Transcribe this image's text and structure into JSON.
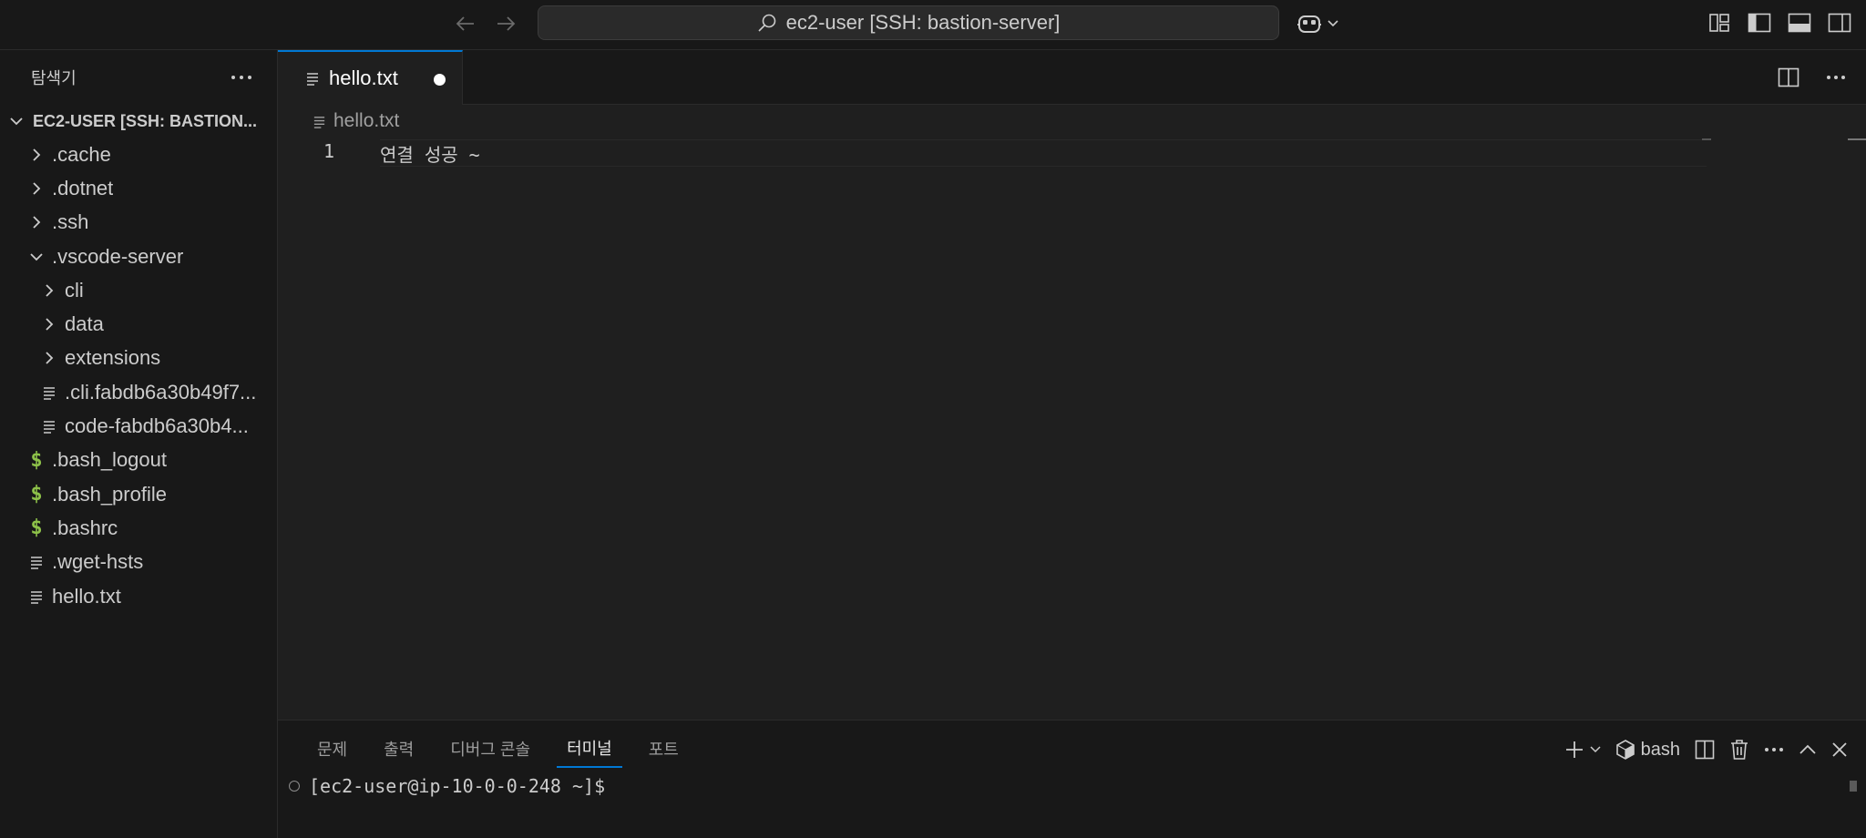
{
  "titlebar": {
    "search_text": "ec2-user [SSH: bastion-server]"
  },
  "sidebar": {
    "title": "탐색기",
    "root_label": "EC2-USER [SSH: BASTION...",
    "items": [
      {
        "label": ".cache",
        "type": "folder-collapsed"
      },
      {
        "label": ".dotnet",
        "type": "folder-collapsed"
      },
      {
        "label": ".ssh",
        "type": "folder-collapsed"
      },
      {
        "label": ".vscode-server",
        "type": "folder-expanded"
      },
      {
        "label": "cli",
        "type": "folder-collapsed"
      },
      {
        "label": "data",
        "type": "folder-collapsed"
      },
      {
        "label": "extensions",
        "type": "folder-collapsed"
      },
      {
        "label": ".cli.fabdb6a30b49f7...",
        "type": "file"
      },
      {
        "label": "code-fabdb6a30b4...",
        "type": "file"
      },
      {
        "label": ".bash_logout",
        "type": "shell"
      },
      {
        "label": ".bash_profile",
        "type": "shell"
      },
      {
        "label": ".bashrc",
        "type": "shell"
      },
      {
        "label": ".wget-hsts",
        "type": "file"
      },
      {
        "label": "hello.txt",
        "type": "file"
      }
    ]
  },
  "editor": {
    "tab_label": "hello.txt",
    "breadcrumb": "hello.txt",
    "line_number": "1",
    "line_text": "연결 성공 ~"
  },
  "panel": {
    "tabs": [
      "문제",
      "출력",
      "디버그 콘솔",
      "터미널",
      "포트"
    ],
    "active_tab": "터미널",
    "shell_label": "bash",
    "prompt": "[ec2-user@ip-10-0-0-248 ~]$"
  },
  "colors": {
    "accent": "#0078d4",
    "shell_icon": "#8dc149",
    "background": "#1f1f1f",
    "sidebar_bg": "#181818"
  }
}
